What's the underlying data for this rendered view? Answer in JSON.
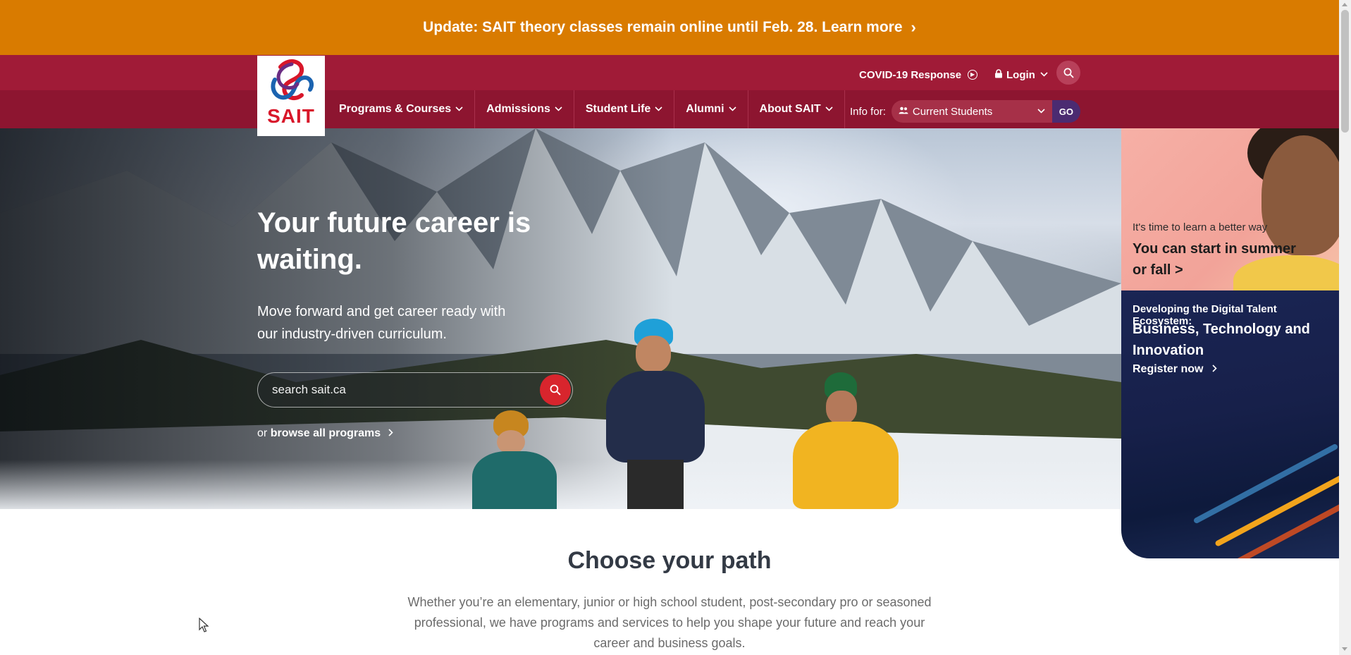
{
  "alert": {
    "text": "Update: SAIT theory classes remain online until Feb. 28. Learn more",
    "chevron": "›"
  },
  "brand": {
    "logo_text": "SAIT",
    "accent": "#d8172a",
    "header_color": "#8d1530",
    "alert_color": "#d97b00"
  },
  "utility": {
    "covid": "COVID-19 Response",
    "login": "Login"
  },
  "nav": {
    "items": [
      {
        "label": "Programs & Courses"
      },
      {
        "label": "Admissions"
      },
      {
        "label": "Student Life"
      },
      {
        "label": "Alumni"
      },
      {
        "label": "About SAIT"
      }
    ]
  },
  "info_for": {
    "label": "Info for:",
    "selected": "Current Students",
    "go": "GO"
  },
  "hero": {
    "headline": "Your future career is waiting.",
    "lead": "Move forward and get career ready with our industry-driven curriculum.",
    "search_placeholder": "search sait.ca",
    "browse_prefix": "or",
    "browse_link": "browse all programs"
  },
  "promo1": {
    "kicker": "It's time to learn a better way",
    "title": "You can start in summer or fall >"
  },
  "promo2": {
    "kicker": "Developing the Digital Talent Ecosystem:",
    "title": "Business, Technology and Innovation",
    "cta": "Register now"
  },
  "section": {
    "title": "Choose your path",
    "body": "Whether you’re an elementary, junior or high school student, post-secondary pro or seasoned professional, we have programs and services to help you shape your future and reach your career and business goals."
  }
}
